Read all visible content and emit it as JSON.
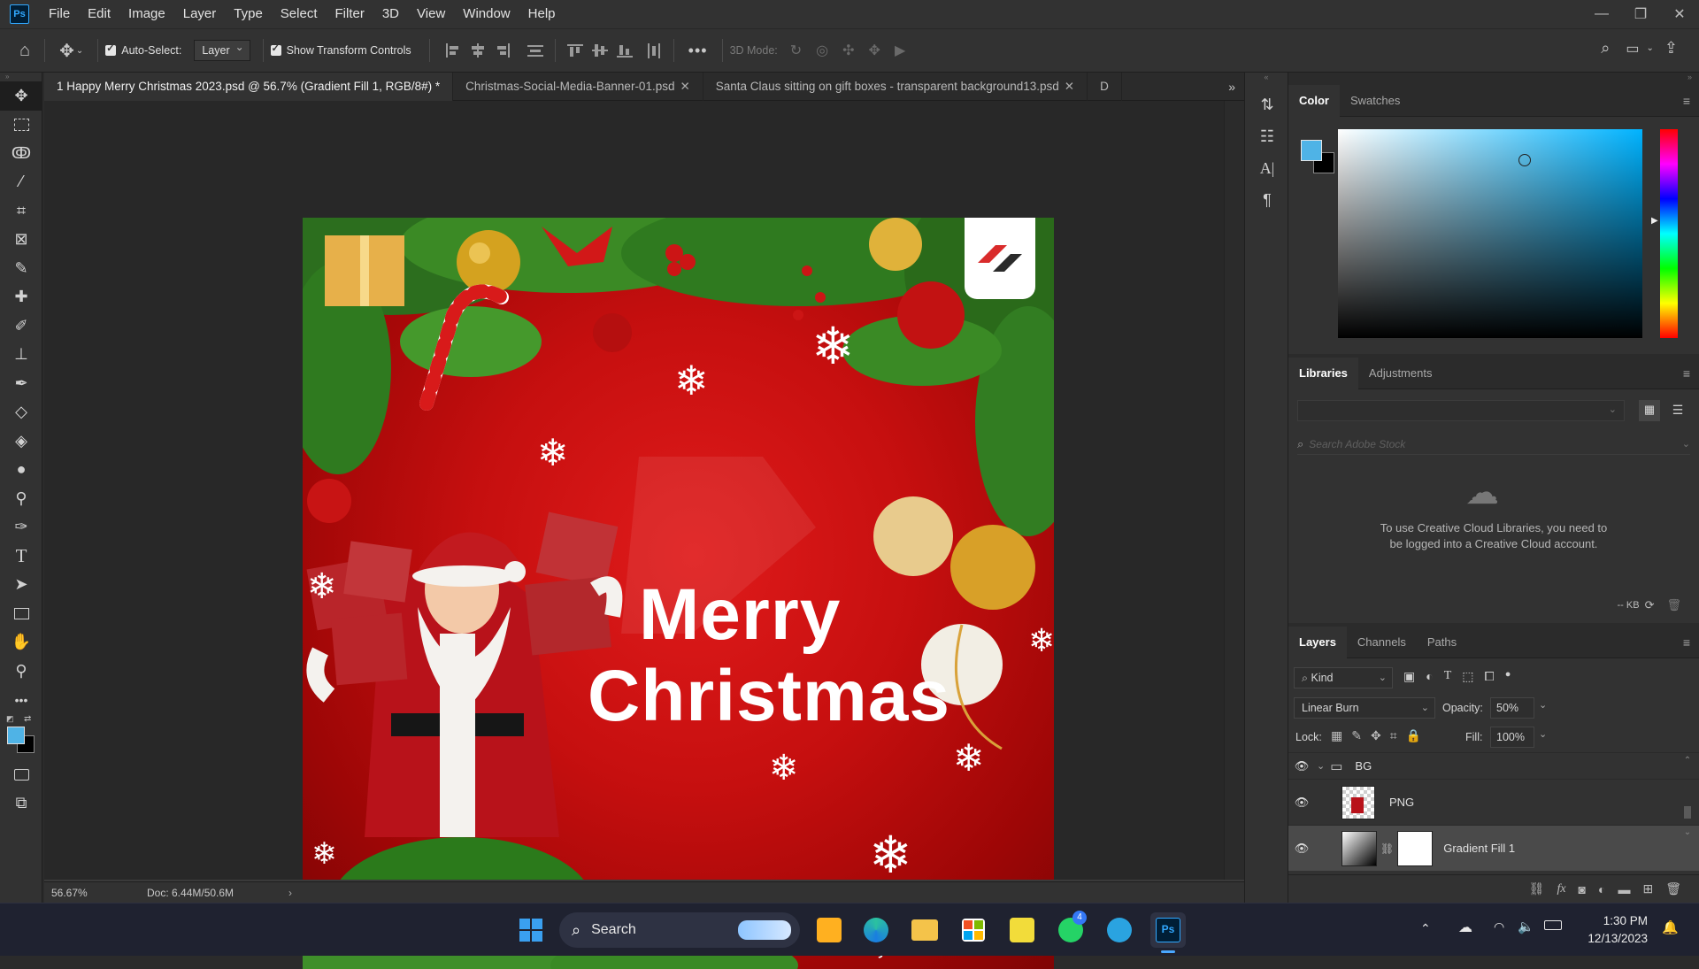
{
  "app": {
    "logo_text": "Ps",
    "menus": [
      "File",
      "Edit",
      "Image",
      "Layer",
      "Type",
      "Select",
      "Filter",
      "3D",
      "View",
      "Window",
      "Help"
    ]
  },
  "options": {
    "auto_select_label": "Auto-Select:",
    "auto_select_value": "Layer",
    "show_transform_label": "Show Transform Controls",
    "mode_3d_label": "3D Mode:"
  },
  "tabs": [
    {
      "label": "1 Happy Merry Christmas 2023.psd @ 56.7% (Gradient Fill 1, RGB/8#) *",
      "active": true
    },
    {
      "label": "Christmas-Social-Media-Banner-01.psd",
      "active": false
    },
    {
      "label": "Santa Claus sitting on gift boxes - transparent background13.psd",
      "active": false
    },
    {
      "label": "D",
      "active": false
    }
  ],
  "artwork": {
    "headline_1": "Merry",
    "headline_2": "Christmas",
    "website": "www.yourwebsite.com"
  },
  "status": {
    "zoom": "56.67%",
    "doc": "Doc: 6.44M/50.6M"
  },
  "color_panel": {
    "tabs": [
      "Color",
      "Swatches"
    ],
    "foreground": "#4fb3e6",
    "background": "#000000"
  },
  "libraries_panel": {
    "tabs": [
      "Libraries",
      "Adjustments"
    ],
    "search_placeholder": "Search Adobe Stock",
    "message": "To use Creative Cloud Libraries, you need to be logged into a Creative Cloud account.",
    "size": "-- KB"
  },
  "layers_panel": {
    "tabs": [
      "Layers",
      "Channels",
      "Paths"
    ],
    "filter_kind": "Kind",
    "blend_mode": "Linear Burn",
    "opacity_label": "Opacity:",
    "opacity_value": "50%",
    "lock_label": "Lock:",
    "fill_label": "Fill:",
    "fill_value": "100%",
    "layers": [
      {
        "name": "BG",
        "type": "group"
      },
      {
        "name": "PNG",
        "type": "image"
      },
      {
        "name": "Gradient Fill 1",
        "type": "fill",
        "selected": true
      }
    ]
  },
  "taskbar": {
    "search_label": "Search",
    "time": "1:30 PM",
    "date": "12/13/2023",
    "whatsapp_badge": "4"
  }
}
